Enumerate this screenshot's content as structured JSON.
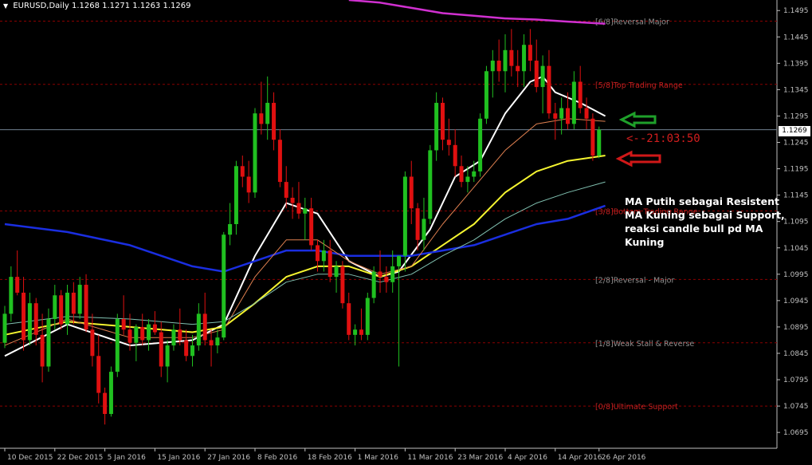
{
  "header": {
    "symbol": "EURUSD,Daily",
    "ohlc": "1.1268 1.1271 1.1263 1.1269",
    "collapse_icon": "triangle-down-icon"
  },
  "annotations": {
    "note": "MA Putih sebagai Resistent\nMA Kuning sebagai Support,\nreaksi candle bull pd MA\nKuning",
    "timer": "<--21:03:50",
    "green_arrow": "left-arrow-icon",
    "red_arrow": "left-arrow-icon"
  },
  "current_price_label": "1.1269",
  "colors": {
    "background": "#000000",
    "bull": "#20c020",
    "bear": "#e01010",
    "ma_white": "#ffffff",
    "ma_yellow": "#f5f530",
    "ma_blue": "#1a2ee0",
    "ma_magenta": "#d030d0",
    "ma_orange": "#e08050",
    "ma_teal": "#80c0b0",
    "murrey_line": "#8b0000",
    "grid_text": "#c0c0c0",
    "arrow_green": "#1fa02a",
    "arrow_red": "#d01818"
  },
  "chart_data": {
    "type": "candlestick",
    "symbol": "EURUSD",
    "timeframe": "Daily",
    "ylim": [
      1.0665,
      1.1515
    ],
    "y_ticks": [
      "1.1495",
      "1.1445",
      "1.1395",
      "1.1345",
      "1.1295",
      "1.1245",
      "1.1195",
      "1.1145",
      "1.1095",
      "1.1045",
      "1.0995",
      "1.0945",
      "1.0895",
      "1.0845",
      "1.0795",
      "1.0745",
      "1.0695"
    ],
    "x_ticks": [
      "10 Dec 2015",
      "22 Dec 2015",
      "5 Jan 2016",
      "15 Jan 2016",
      "27 Jan 2016",
      "8 Feb 2016",
      "18 Feb 2016",
      "1 Mar 2016",
      "11 Mar 2016",
      "23 Mar 2016",
      "4 Apr 2016",
      "14 Apr 2016",
      "26 Apr 2016"
    ],
    "murrey_levels": [
      {
        "label": "[6/8]Reversal Major",
        "value": 1.1475
      },
      {
        "label": "[5/8]Top Trading Range",
        "value": 1.1355
      },
      {
        "label": "[3/8]Bottom Trading Range",
        "value": 1.1115
      },
      {
        "label": "[2/8]Reversal - Major",
        "value": 1.0985
      },
      {
        "label": "[1/8]Weak Stall & Reverse",
        "value": 1.0865
      },
      {
        "label": "[0/8]Ultimate Support",
        "value": 1.0745
      }
    ],
    "current_price": 1.1269,
    "candles": [
      [
        1.0865,
        1.0935,
        1.0855,
        1.092
      ],
      [
        1.092,
        1.101,
        1.0905,
        1.099
      ],
      [
        1.099,
        1.104,
        1.0955,
        1.096
      ],
      [
        1.096,
        1.099,
        1.085,
        1.087
      ],
      [
        1.087,
        1.096,
        1.086,
        1.094
      ],
      [
        1.094,
        1.095,
        1.086,
        1.088
      ],
      [
        1.088,
        1.092,
        1.079,
        1.082
      ],
      [
        1.082,
        1.093,
        1.081,
        1.091
      ],
      [
        1.091,
        1.0975,
        1.089,
        1.0955
      ],
      [
        1.0955,
        1.0965,
        1.089,
        1.09
      ],
      [
        1.09,
        1.0975,
        1.088,
        1.096
      ],
      [
        1.096,
        1.098,
        1.09,
        1.092
      ],
      [
        1.092,
        1.099,
        1.091,
        1.0975
      ],
      [
        1.0975,
        1.0995,
        1.0885,
        1.089
      ],
      [
        1.089,
        1.092,
        1.082,
        1.084
      ],
      [
        1.084,
        1.088,
        1.075,
        1.077
      ],
      [
        1.077,
        1.078,
        1.071,
        1.073
      ],
      [
        1.073,
        1.082,
        1.0725,
        1.081
      ],
      [
        1.081,
        1.092,
        1.08,
        1.091
      ],
      [
        1.091,
        1.0955,
        1.088,
        1.089
      ],
      [
        1.089,
        1.092,
        1.085,
        1.0865
      ],
      [
        1.0865,
        1.09,
        1.083,
        1.0895
      ],
      [
        1.0895,
        1.092,
        1.086,
        1.087
      ],
      [
        1.087,
        1.091,
        1.085,
        1.09
      ],
      [
        1.09,
        1.0925,
        1.088,
        1.0885
      ],
      [
        1.0885,
        1.0905,
        1.08,
        1.082
      ],
      [
        1.082,
        1.087,
        1.079,
        1.086
      ],
      [
        1.086,
        1.09,
        1.085,
        1.089
      ],
      [
        1.089,
        1.093,
        1.086,
        1.087
      ],
      [
        1.087,
        1.089,
        1.083,
        1.084
      ],
      [
        1.084,
        1.088,
        1.082,
        1.086
      ],
      [
        1.086,
        1.094,
        1.085,
        1.092
      ],
      [
        1.092,
        1.096,
        1.086,
        1.087
      ],
      [
        1.087,
        1.089,
        1.082,
        1.086
      ],
      [
        1.086,
        1.089,
        1.0845,
        1.0875
      ],
      [
        1.0875,
        1.1075,
        1.087,
        1.107
      ],
      [
        1.107,
        1.113,
        1.105,
        1.109
      ],
      [
        1.109,
        1.121,
        1.107,
        1.12
      ],
      [
        1.12,
        1.122,
        1.116,
        1.118
      ],
      [
        1.118,
        1.121,
        1.113,
        1.115
      ],
      [
        1.115,
        1.131,
        1.114,
        1.13
      ],
      [
        1.13,
        1.136,
        1.126,
        1.128
      ],
      [
        1.128,
        1.137,
        1.125,
        1.132
      ],
      [
        1.132,
        1.134,
        1.123,
        1.125
      ],
      [
        1.125,
        1.127,
        1.116,
        1.117
      ],
      [
        1.117,
        1.12,
        1.112,
        1.114
      ],
      [
        1.114,
        1.116,
        1.11,
        1.113
      ],
      [
        1.113,
        1.117,
        1.11,
        1.111
      ],
      [
        1.111,
        1.114,
        1.106,
        1.112
      ],
      [
        1.112,
        1.114,
        1.104,
        1.105
      ],
      [
        1.105,
        1.106,
        1.1,
        1.102
      ],
      [
        1.102,
        1.106,
        1.1,
        1.104
      ],
      [
        1.104,
        1.106,
        1.098,
        1.099
      ],
      [
        1.099,
        1.102,
        1.096,
        1.101
      ],
      [
        1.101,
        1.102,
        1.093,
        1.094
      ],
      [
        1.094,
        1.096,
        1.087,
        1.088
      ],
      [
        1.088,
        1.09,
        1.086,
        1.089
      ],
      [
        1.089,
        1.093,
        1.087,
        1.088
      ],
      [
        1.088,
        1.096,
        1.087,
        1.095
      ],
      [
        1.095,
        1.101,
        1.094,
        1.1
      ],
      [
        1.1,
        1.104,
        1.096,
        1.099
      ],
      [
        1.099,
        1.101,
        1.096,
        1.098
      ],
      [
        1.098,
        1.104,
        1.096,
        1.101
      ],
      [
        1.101,
        1.103,
        1.082,
        1.103
      ],
      [
        1.103,
        1.119,
        1.1,
        1.118
      ],
      [
        1.118,
        1.121,
        1.109,
        1.112
      ],
      [
        1.112,
        1.113,
        1.104,
        1.106
      ],
      [
        1.106,
        1.114,
        1.104,
        1.11
      ],
      [
        1.11,
        1.124,
        1.109,
        1.123
      ],
      [
        1.123,
        1.134,
        1.121,
        1.132
      ],
      [
        1.132,
        1.133,
        1.123,
        1.125
      ],
      [
        1.125,
        1.129,
        1.122,
        1.124
      ],
      [
        1.124,
        1.127,
        1.118,
        1.12
      ],
      [
        1.12,
        1.122,
        1.116,
        1.117
      ],
      [
        1.117,
        1.12,
        1.115,
        1.118
      ],
      [
        1.118,
        1.121,
        1.117,
        1.119
      ],
      [
        1.119,
        1.13,
        1.118,
        1.129
      ],
      [
        1.129,
        1.139,
        1.128,
        1.138
      ],
      [
        1.138,
        1.142,
        1.133,
        1.14
      ],
      [
        1.14,
        1.144,
        1.136,
        1.138
      ],
      [
        1.138,
        1.145,
        1.134,
        1.142
      ],
      [
        1.142,
        1.146,
        1.137,
        1.139
      ],
      [
        1.139,
        1.142,
        1.135,
        1.138
      ],
      [
        1.138,
        1.145,
        1.135,
        1.143
      ],
      [
        1.143,
        1.146,
        1.138,
        1.14
      ],
      [
        1.14,
        1.144,
        1.134,
        1.135
      ],
      [
        1.135,
        1.141,
        1.13,
        1.139
      ],
      [
        1.139,
        1.142,
        1.129,
        1.13
      ],
      [
        1.13,
        1.132,
        1.125,
        1.129
      ],
      [
        1.129,
        1.133,
        1.126,
        1.131
      ],
      [
        1.131,
        1.134,
        1.127,
        1.128
      ],
      [
        1.128,
        1.138,
        1.127,
        1.136
      ],
      [
        1.136,
        1.139,
        1.13,
        1.131
      ],
      [
        1.131,
        1.133,
        1.127,
        1.129
      ],
      [
        1.129,
        1.13,
        1.121,
        1.122
      ],
      [
        1.122,
        1.1275,
        1.1215,
        1.1269
      ]
    ],
    "moving_averages": [
      {
        "color": "white",
        "points": [
          [
            0,
            1.084
          ],
          [
            10,
            1.09
          ],
          [
            20,
            1.086
          ],
          [
            30,
            1.087
          ],
          [
            35,
            1.09
          ],
          [
            40,
            1.103
          ],
          [
            45,
            1.113
          ],
          [
            50,
            1.111
          ],
          [
            55,
            1.102
          ],
          [
            60,
            1.099
          ],
          [
            63,
            1.1
          ],
          [
            68,
            1.108
          ],
          [
            72,
            1.118
          ],
          [
            76,
            1.121
          ],
          [
            80,
            1.13
          ],
          [
            84,
            1.136
          ],
          [
            86,
            1.137
          ],
          [
            88,
            1.134
          ],
          [
            92,
            1.132
          ],
          [
            96,
            1.1295
          ]
        ]
      },
      {
        "color": "yellow",
        "points": [
          [
            0,
            1.088
          ],
          [
            10,
            1.0905
          ],
          [
            20,
            1.0895
          ],
          [
            30,
            1.0885
          ],
          [
            35,
            1.0895
          ],
          [
            40,
            1.094
          ],
          [
            45,
            1.099
          ],
          [
            50,
            1.101
          ],
          [
            55,
            1.101
          ],
          [
            60,
            1.099
          ],
          [
            65,
            1.101
          ],
          [
            70,
            1.105
          ],
          [
            75,
            1.109
          ],
          [
            80,
            1.115
          ],
          [
            85,
            1.119
          ],
          [
            90,
            1.121
          ],
          [
            96,
            1.122
          ]
        ]
      },
      {
        "color": "blue",
        "points": [
          [
            0,
            1.109
          ],
          [
            10,
            1.1075
          ],
          [
            20,
            1.105
          ],
          [
            30,
            1.101
          ],
          [
            35,
            1.1
          ],
          [
            40,
            1.102
          ],
          [
            45,
            1.104
          ],
          [
            50,
            1.104
          ],
          [
            55,
            1.103
          ],
          [
            60,
            1.103
          ],
          [
            65,
            1.103
          ],
          [
            70,
            1.104
          ],
          [
            75,
            1.105
          ],
          [
            80,
            1.107
          ],
          [
            85,
            1.109
          ],
          [
            90,
            1.11
          ],
          [
            96,
            1.1125
          ]
        ]
      },
      {
        "color": "magenta",
        "points": [
          [
            55,
            1.1515
          ],
          [
            60,
            1.151
          ],
          [
            65,
            1.15
          ],
          [
            70,
            1.149
          ],
          [
            75,
            1.1485
          ],
          [
            80,
            1.148
          ],
          [
            85,
            1.1478
          ],
          [
            90,
            1.1474
          ],
          [
            96,
            1.147
          ]
        ]
      },
      {
        "color": "orange",
        "points": [
          [
            0,
            1.086
          ],
          [
            10,
            1.091
          ],
          [
            20,
            1.0875
          ],
          [
            30,
            1.0875
          ],
          [
            35,
            1.089
          ],
          [
            40,
            1.099
          ],
          [
            45,
            1.106
          ],
          [
            50,
            1.106
          ],
          [
            55,
            1.102
          ],
          [
            60,
            1.0995
          ],
          [
            65,
            1.101
          ],
          [
            70,
            1.109
          ],
          [
            75,
            1.116
          ],
          [
            80,
            1.123
          ],
          [
            85,
            1.128
          ],
          [
            90,
            1.129
          ],
          [
            96,
            1.1285
          ]
        ]
      },
      {
        "color": "teal",
        "points": [
          [
            0,
            1.09
          ],
          [
            10,
            1.0915
          ],
          [
            20,
            1.091
          ],
          [
            30,
            1.09
          ],
          [
            35,
            1.0905
          ],
          [
            40,
            1.094
          ],
          [
            45,
            1.098
          ],
          [
            50,
            1.0995
          ],
          [
            55,
            1.0995
          ],
          [
            60,
            1.098
          ],
          [
            65,
            1.0995
          ],
          [
            70,
            1.103
          ],
          [
            75,
            1.106
          ],
          [
            80,
            1.11
          ],
          [
            85,
            1.113
          ],
          [
            90,
            1.115
          ],
          [
            96,
            1.117
          ]
        ]
      }
    ]
  }
}
